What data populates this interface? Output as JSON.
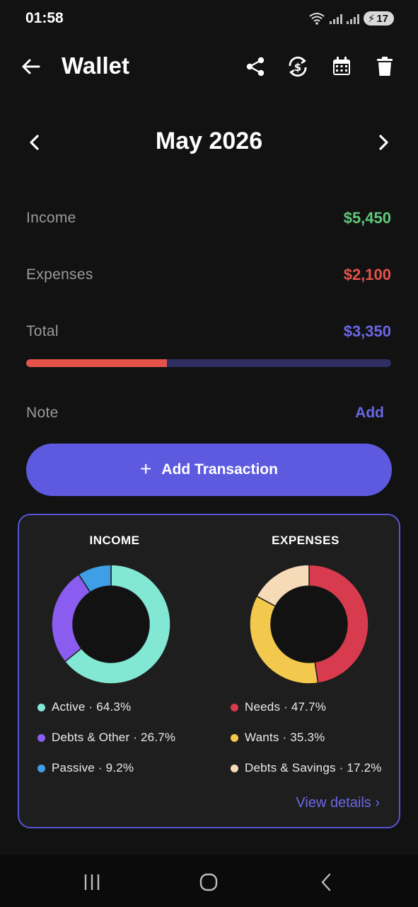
{
  "status_bar": {
    "time": "01:58",
    "battery": "17",
    "icons": [
      "wifi-icon",
      "signal-icon",
      "signal-icon",
      "battery-charging-icon"
    ]
  },
  "header": {
    "title": "Wallet",
    "icons": [
      "back-arrow-icon",
      "share-icon",
      "currency-sync-icon",
      "calendar-icon",
      "trash-icon"
    ]
  },
  "month_nav": {
    "label": "May 2026"
  },
  "summary": {
    "income_label": "Income",
    "income_value": "$5,450",
    "expenses_label": "Expenses",
    "expenses_value": "$2,100",
    "total_label": "Total",
    "total_value": "$3,350",
    "expense_ratio": 0.385
  },
  "note": {
    "label": "Note",
    "action": "Add"
  },
  "add_transaction": {
    "label": "Add Transaction"
  },
  "charts": {
    "income_title": "INCOME",
    "expenses_title": "EXPENSES",
    "income_legend": [
      "Active · 64.3%",
      "Debts & Other · 26.7%",
      "Passive · 9.2%"
    ],
    "expenses_legend": [
      "Needs · 47.7%",
      "Wants · 35.3%",
      "Debts & Savings · 17.2%"
    ],
    "view_details": "View details"
  },
  "chart_data": [
    {
      "type": "pie",
      "title": "INCOME",
      "categories": [
        "Active",
        "Debts & Other",
        "Passive"
      ],
      "values": [
        64.3,
        26.7,
        9.2
      ],
      "colors": [
        "#82e8d4",
        "#8b5cf0",
        "#3e9ee6"
      ]
    },
    {
      "type": "pie",
      "title": "EXPENSES",
      "categories": [
        "Needs",
        "Wants",
        "Debts & Savings"
      ],
      "values": [
        47.7,
        35.3,
        17.2
      ],
      "colors": [
        "#d83a4e",
        "#f2c94c",
        "#f7dbb8"
      ]
    }
  ],
  "colors": {
    "income": "#5fc97a",
    "expenses": "#e5534b",
    "total": "#6a67e6",
    "accent": "#5d5ae0"
  },
  "nav_bar": {
    "icons": [
      "recent-apps-icon",
      "home-icon",
      "nav-back-icon"
    ]
  }
}
